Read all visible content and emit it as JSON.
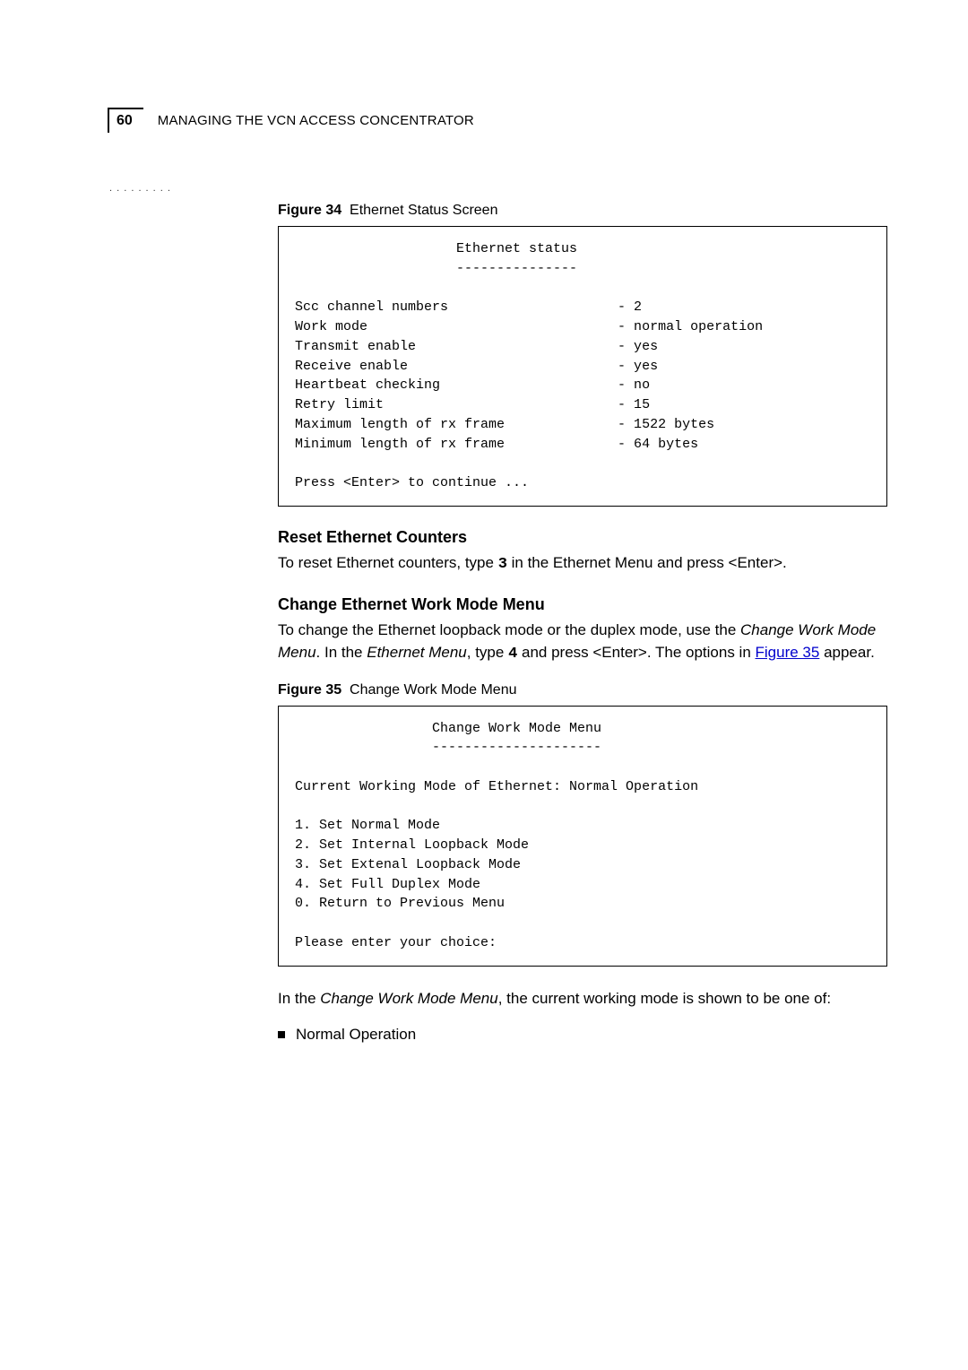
{
  "header": {
    "page_number": "60",
    "title_prefix": "M",
    "title_rest_1": "ANAGING",
    "title_mid": " THE ",
    "title_vcn": "VCN A",
    "title_rest_2": "CCESS",
    "title_c": " C",
    "title_rest_3": "ONCENTRATOR",
    "dots": ". . . . . . . . ."
  },
  "figure34": {
    "label": "Figure 34",
    "caption": "Ethernet Status Screen",
    "title_line": "                    Ethernet status",
    "dash_line": "                    ---------------",
    "rows": [
      {
        "left": "Scc channel numbers",
        "right": "- 2"
      },
      {
        "left": "Work mode",
        "right": "- normal operation"
      },
      {
        "left": "Transmit enable",
        "right": "- yes"
      },
      {
        "left": "Receive enable",
        "right": "- yes"
      },
      {
        "left": "Heartbeat checking",
        "right": "- no"
      },
      {
        "left": "Retry limit",
        "right": "- 15"
      },
      {
        "left": "Maximum length of rx frame",
        "right": "- 1522 bytes"
      },
      {
        "left": "Minimum length of rx frame",
        "right": "- 64 bytes"
      }
    ],
    "prompt": "Press <Enter> to continue ..."
  },
  "reset_section": {
    "heading": "Reset Ethernet Counters",
    "body_1": "To reset Ethernet counters, type ",
    "key": "3",
    "body_2": " in the Ethernet Menu and press <Enter>."
  },
  "change_section": {
    "heading": "Change Ethernet Work Mode Menu",
    "body_1": "To change the Ethernet loopback mode or the duplex mode, use the ",
    "italic_1": "Change Work Mode Menu",
    "body_2": ". In the ",
    "italic_2": "Ethernet Menu",
    "body_3": ", type ",
    "key": "4",
    "body_4": " and press <Enter>. The options in ",
    "link": "Figure 35",
    "body_5": " appear."
  },
  "figure35": {
    "label": "Figure 35",
    "caption": "Change Work Mode Menu",
    "title_line": "                 Change Work Mode Menu",
    "dash_line": "                 ---------------------",
    "current_line": "Current Working Mode of Ethernet: Normal Operation",
    "menu_items": [
      "1. Set Normal Mode",
      "2. Set Internal Loopback Mode",
      "3. Set Extenal Loopback Mode",
      "4. Set Full Duplex Mode",
      "0. Return to Previous Menu"
    ],
    "prompt": "Please enter your choice:"
  },
  "footer_para": {
    "body_1": "In the ",
    "italic_1": "Change Work Mode Menu",
    "body_2": ", the current working mode is shown to be one of:"
  },
  "bullet": {
    "text": "Normal Operation"
  }
}
